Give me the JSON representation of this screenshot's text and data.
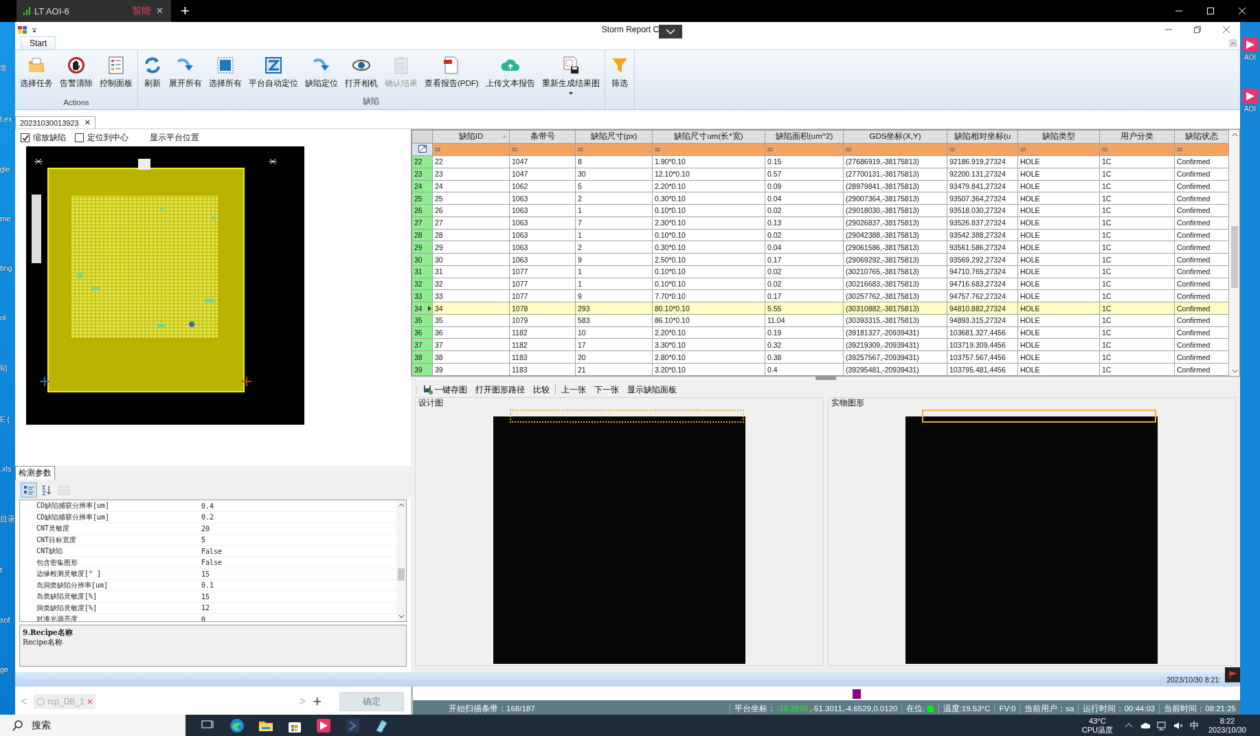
{
  "browser_tabs": [
    {
      "label": "LT AOI-6",
      "badge": "智能",
      "close": "×",
      "selected": true
    }
  ],
  "new_tab": "+",
  "desktop_left": [
    "常",
    "t.ex",
    "gle",
    "me",
    "ting",
    "ol",
    "站",
    "E (",
    ".xls",
    "目录",
    "t",
    "sof",
    "ge"
  ],
  "desktop_right": [
    "AOI",
    "AOI"
  ],
  "window": {
    "title": "Storm Report C"
  },
  "ribbon": {
    "tabs": [
      {
        "label": "Start",
        "selected": true
      }
    ],
    "groups": [
      {
        "label": "Actions",
        "buttons": [
          {
            "label": "选择任务",
            "disabled": false,
            "dropdown": false
          },
          {
            "label": "告警清除",
            "disabled": false,
            "dropdown": false
          },
          {
            "label": "控制面板",
            "disabled": false,
            "dropdown": false
          }
        ]
      },
      {
        "label": "缺陷",
        "buttons": [
          {
            "label": "刷新",
            "disabled": false,
            "dropdown": false
          },
          {
            "label": "展开所有",
            "disabled": false,
            "dropdown": false
          },
          {
            "label": "选择所有",
            "disabled": false,
            "dropdown": false
          },
          {
            "label": "平台自动定位",
            "disabled": false,
            "dropdown": false
          },
          {
            "label": "缺陷定位",
            "disabled": false,
            "dropdown": false
          },
          {
            "label": "打开相机",
            "disabled": false,
            "dropdown": false
          },
          {
            "label": "确认结果",
            "disabled": true,
            "dropdown": false
          },
          {
            "label": "查看报告(PDF)",
            "disabled": false,
            "dropdown": false
          },
          {
            "label": "上传文本报告",
            "disabled": false,
            "dropdown": false
          },
          {
            "label": "重新生成结果图",
            "disabled": false,
            "dropdown": true
          }
        ]
      },
      {
        "buttons": [
          {
            "label": "筛选",
            "disabled": false,
            "dropdown": false
          }
        ]
      }
    ]
  },
  "document_tabs": [
    {
      "label": "20231030013923",
      "close": "✕",
      "selected": true
    }
  ],
  "left_panel": {
    "options": [
      {
        "kind": "checkbox",
        "label": "缩放缺陷",
        "checked": true
      },
      {
        "kind": "checkbox",
        "label": "定位到中心",
        "checked": false
      },
      {
        "kind": "label",
        "label": "显示平台位置"
      }
    ]
  },
  "parameters": {
    "tabs": [
      {
        "label": "检测参数",
        "selected": true
      }
    ],
    "tools": [
      {
        "selected": true,
        "disabled": false
      },
      {
        "selected": false,
        "disabled": false
      },
      {
        "selected": false,
        "disabled": true
      }
    ],
    "rows": [
      {
        "name": "CD缺陷捕获分辨率[um]",
        "value": "0.4"
      },
      {
        "name": "CD缺陷捕获分辨率[um]",
        "value": "0.2"
      },
      {
        "name": "CNT灵敏度",
        "value": "20"
      },
      {
        "name": "CNT目标宽度",
        "value": "5"
      },
      {
        "name": "CNT缺陷",
        "value": "False"
      },
      {
        "name": "包含密集图形",
        "value": "False"
      },
      {
        "name": "边缘检测灵敏度[° ]",
        "value": "15"
      },
      {
        "name": "岛洞类缺陷分辨率[um]",
        "value": "0.1"
      },
      {
        "name": "岛类缺陷灵敏度[%]",
        "value": "15"
      },
      {
        "name": "洞类缺陷灵敏度[%]",
        "value": "12"
      },
      {
        "name": "对准光源亮度",
        "value": "0"
      }
    ],
    "description": {
      "title": "9.Recipe名称",
      "text": "Recipe名称"
    }
  },
  "table": {
    "columns": [
      "缺陷ID",
      "条带号",
      "缺陷尺寸(px)",
      "缺陷尺寸um(长*宽)",
      "缺陷面积(um^2)",
      "GDS坐标(X,Y)",
      "缺陷相对坐标(u",
      "缺陷类型",
      "用户分类",
      "缺陷状态"
    ],
    "rows": [
      {
        "header": "22",
        "selected": false,
        "cells": [
          "22",
          "1047",
          "8",
          "1.90*0.10",
          "0.15",
          "(27686919,-38175813)",
          "92186.919,27324",
          "HOLE",
          "1C",
          "Confirmed"
        ]
      },
      {
        "header": "23",
        "selected": false,
        "cells": [
          "23",
          "1047",
          "30",
          "12.10*0.10",
          "0.57",
          "(27700131,-38175813)",
          "92200.131,27324",
          "HOLE",
          "1C",
          "Confirmed"
        ]
      },
      {
        "header": "24",
        "selected": false,
        "cells": [
          "24",
          "1062",
          "5",
          "2.20*0.10",
          "0.09",
          "(28979841,-38175813)",
          "93479.841,27324",
          "HOLE",
          "1C",
          "Confirmed"
        ]
      },
      {
        "header": "25",
        "selected": false,
        "cells": [
          "25",
          "1063",
          "2",
          "0.30*0.10",
          "0.04",
          "(29007364,-38175813)",
          "93507.364,27324",
          "HOLE",
          "1C",
          "Confirmed"
        ]
      },
      {
        "header": "26",
        "selected": false,
        "cells": [
          "26",
          "1063",
          "1",
          "0.10*0.10",
          "0.02",
          "(29018030,-38175813)",
          "93518.030,27324",
          "HOLE",
          "1C",
          "Confirmed"
        ]
      },
      {
        "header": "27",
        "selected": false,
        "cells": [
          "27",
          "1063",
          "7",
          "2.30*0.10",
          "0.13",
          "(29026837,-38175813)",
          "93526.837,27324",
          "HOLE",
          "1C",
          "Confirmed"
        ]
      },
      {
        "header": "28",
        "selected": false,
        "cells": [
          "28",
          "1063",
          "1",
          "0.10*0.10",
          "0.02",
          "(29042388,-38175813)",
          "93542.388,27324",
          "HOLE",
          "1C",
          "Confirmed"
        ]
      },
      {
        "header": "29",
        "selected": false,
        "cells": [
          "29",
          "1063",
          "2",
          "0.30*0.10",
          "0.04",
          "(29061586,-38175813)",
          "93561.586,27324",
          "HOLE",
          "1C",
          "Confirmed"
        ]
      },
      {
        "header": "30",
        "selected": false,
        "cells": [
          "30",
          "1063",
          "9",
          "2.50*0.10",
          "0.17",
          "(29069292,-38175813)",
          "93569.292,27324",
          "HOLE",
          "1C",
          "Confirmed"
        ]
      },
      {
        "header": "31",
        "selected": false,
        "cells": [
          "31",
          "1077",
          "1",
          "0.10*0.10",
          "0.02",
          "(30210765,-38175813)",
          "94710.765,27324",
          "HOLE",
          "1C",
          "Confirmed"
        ]
      },
      {
        "header": "32",
        "selected": false,
        "cells": [
          "32",
          "1077",
          "1",
          "0.10*0.10",
          "0.02",
          "(30216683,-38175813)",
          "94716.683,27324",
          "HOLE",
          "1C",
          "Confirmed"
        ]
      },
      {
        "header": "33",
        "selected": false,
        "cells": [
          "33",
          "1077",
          "9",
          "7.70*0.10",
          "0.17",
          "(30257762,-38175813)",
          "94757.762,27324",
          "HOLE",
          "1C",
          "Confirmed"
        ]
      },
      {
        "header": "34",
        "selected": true,
        "cells": [
          "34",
          "1078",
          "293",
          "80.10*0.10",
          "5.55",
          "(30310882,-38175813)",
          "94810.882,27324",
          "HOLE",
          "1C",
          "Confirmed"
        ]
      },
      {
        "header": "35",
        "selected": false,
        "cells": [
          "35",
          "1079",
          "583",
          "86.10*0.10",
          "11.04",
          "(30393315,-38175813)",
          "94893.315,27324",
          "HOLE",
          "1C",
          "Confirmed"
        ]
      },
      {
        "header": "36",
        "selected": false,
        "cells": [
          "36",
          "1182",
          "10",
          "2.20*0.10",
          "0.19",
          "(39181327,-20939431)",
          "103681.327,4456",
          "HOLE",
          "1C",
          "Confirmed"
        ]
      },
      {
        "header": "37",
        "selected": false,
        "cells": [
          "37",
          "1182",
          "17",
          "3.30*0.10",
          "0.32",
          "(39219309,-20939431)",
          "103719.309,4456",
          "HOLE",
          "1C",
          "Confirmed"
        ]
      },
      {
        "header": "38",
        "selected": false,
        "cells": [
          "38",
          "1183",
          "20",
          "2.80*0.10",
          "0.38",
          "(39257567,-20939431)",
          "103757.567,4456",
          "HOLE",
          "1C",
          "Confirmed"
        ]
      },
      {
        "header": "39",
        "selected": false,
        "cells": [
          "39",
          "1183",
          "21",
          "3.20*0.10",
          "0.4",
          "(39295481,-20939431)",
          "103795.481,4456",
          "HOLE",
          "1C",
          "Confirmed"
        ]
      }
    ]
  },
  "image_toolbar": {
    "groups": [
      [
        "一键存图",
        "打开图形路径",
        "比较"
      ],
      [
        "上一张",
        "下一张",
        "显示缺陷面板"
      ]
    ]
  },
  "image_panels": [
    {
      "title": "设计图",
      "kind": "dashed"
    },
    {
      "title": "实物图形",
      "kind": "solid"
    }
  ],
  "timestamp": "2023/10/30  8:21:",
  "recipe_bar": {
    "prev": "<",
    "tabs": [
      {
        "label": "rcp_DB_1",
        "close": "×"
      }
    ],
    "next": ">",
    "add": "+",
    "confirm": {
      "label": "确定",
      "disabled": true
    }
  },
  "status_bar": [
    {
      "kind": "text",
      "text": "开始扫描条带：168/187"
    },
    {
      "kind": "coords",
      "label": "平台坐标：",
      "highlight": "-18.2595",
      "text": ",-51.3011,-4.6529,0.0120"
    },
    {
      "kind": "indicator",
      "label": "在位:",
      "on": true
    },
    {
      "kind": "text",
      "text": "温度:19.53°C"
    },
    {
      "kind": "text",
      "text": "FV:0"
    },
    {
      "kind": "text",
      "text": "当前用户：sa"
    },
    {
      "kind": "text",
      "text": "运行时间：00:44:03"
    },
    {
      "kind": "text",
      "text": "当前时间：08:21:25"
    }
  ],
  "taskbar": {
    "search": "搜索",
    "temperature": "43°C",
    "temperature_label": "CPU温度",
    "ime": "中",
    "time": "8:22",
    "date": "2023/10/30"
  }
}
